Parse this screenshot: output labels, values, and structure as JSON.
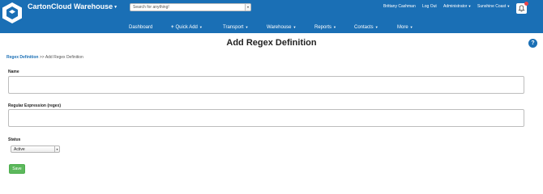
{
  "header": {
    "brand": "CartonCloud Warehouse",
    "search_placeholder": "Search for anything!",
    "user_name": "Brittany Cashman",
    "logout": "Log Out",
    "role": "Administrator",
    "location": "Sunshine Coast",
    "colors": {
      "bar": "#1a6fb5",
      "notification": "#e8454a"
    }
  },
  "nav": {
    "dashboard": "Dashboard",
    "quick_add": "Quick Add",
    "transport": "Transport",
    "warehouse": "Warehouse",
    "reports": "Reports",
    "contacts": "Contacts",
    "more": "More"
  },
  "page": {
    "title": "Add Regex Definition",
    "help": "?",
    "breadcrumb": {
      "link": "Regex Definition",
      "separator": ">>",
      "current": "Add Regex Definition"
    }
  },
  "form": {
    "name_label": "Name",
    "name_value": "",
    "regex_label": "Regular Expression (regex)",
    "regex_value": "",
    "status_label": "Status",
    "status_value": "Active",
    "save_label": "Save",
    "save_color": "#5cb85c"
  }
}
